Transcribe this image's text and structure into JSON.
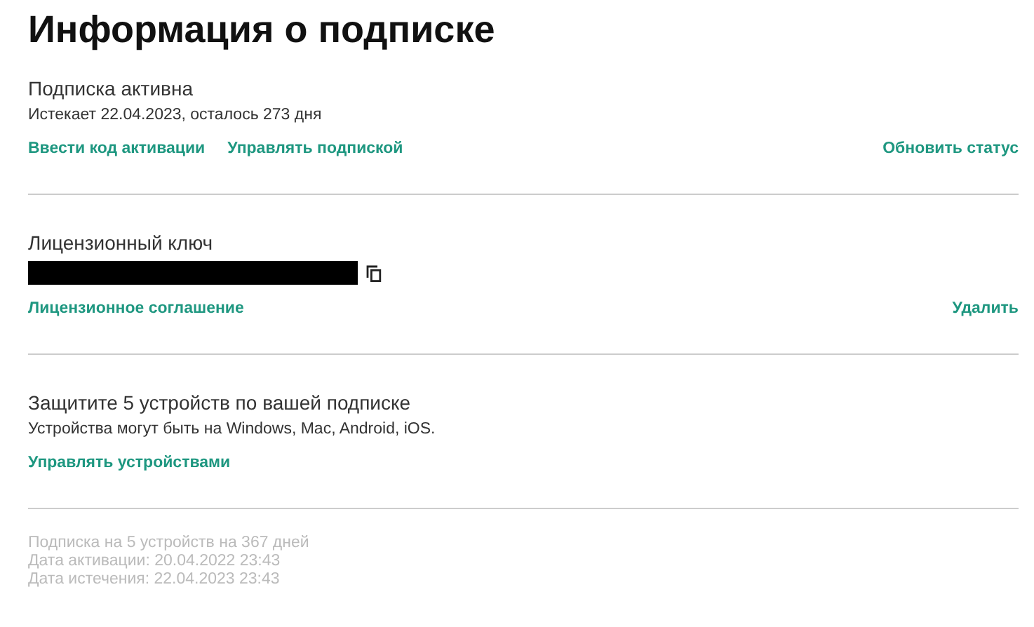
{
  "title": "Информация о подписке",
  "sections": [
    {
      "heading": "Подписка активна",
      "text": "Истекает 22.04.2023, осталось 273 дня",
      "links": [
        "Ввести код активации",
        "Управлять подпиской"
      ],
      "right_link": "Обновить статус"
    },
    {
      "heading": "Лицензионный ключ",
      "key": {
        "redacted": true
      },
      "links": [
        "Лицензионное соглашение"
      ],
      "right_link": "Удалить"
    },
    {
      "heading": "Защитите 5 устройств по вашей подписке",
      "text": "Устройства могут быть на Windows, Mac, Android, iOS.",
      "links": [
        "Управлять устройствами"
      ]
    }
  ],
  "footer": [
    "Подписка на 5 устройств на 367 дней",
    "Дата активации: 20.04.2022 23:43",
    "Дата истечения: 22.04.2023 23:43"
  ]
}
